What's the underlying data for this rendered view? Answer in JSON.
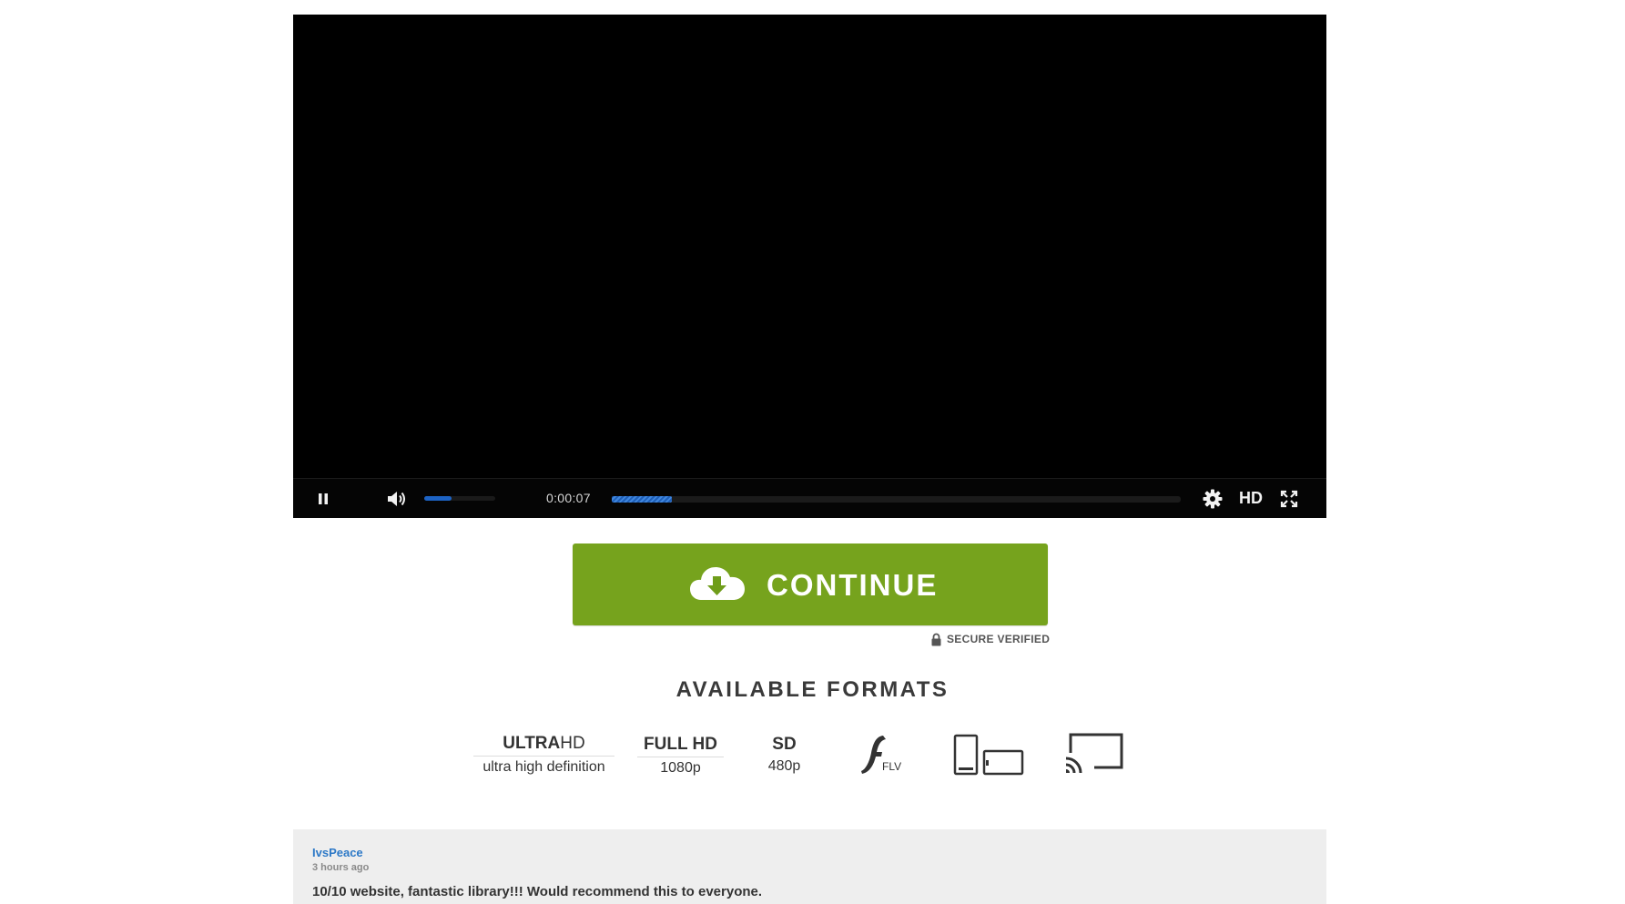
{
  "player": {
    "time": "0:00:07",
    "volume_fraction": 0.38,
    "buffered_fraction": 0.105,
    "quality_label": "HD",
    "icons": [
      "pause-icon",
      "volume-icon",
      "gear-icon",
      "fullscreen-icon"
    ]
  },
  "cta": {
    "label": "CONTINUE",
    "icon": "cloud-download-icon",
    "secure_label": "SECURE VERIFIED",
    "colors": {
      "button": "#76a31d",
      "text": "#ffffff"
    }
  },
  "formats": {
    "heading": "AVAILABLE FORMATS",
    "items": [
      {
        "main_bold": "ULTRA",
        "main_light": "HD",
        "sub": "ultra high definition"
      },
      {
        "main_bold": "FULL HD",
        "main_light": "",
        "sub": "1080p"
      },
      {
        "main_bold": "SD",
        "main_light": "",
        "sub": "480p"
      }
    ],
    "flv_label": "FLV",
    "icons": [
      "flash-flv-icon",
      "devices-icon",
      "cast-icon"
    ]
  },
  "comment": {
    "author": "IvsPeace",
    "time": "3 hours ago",
    "text": "10/10 website, fantastic library!!! Would recommend this to everyone."
  }
}
